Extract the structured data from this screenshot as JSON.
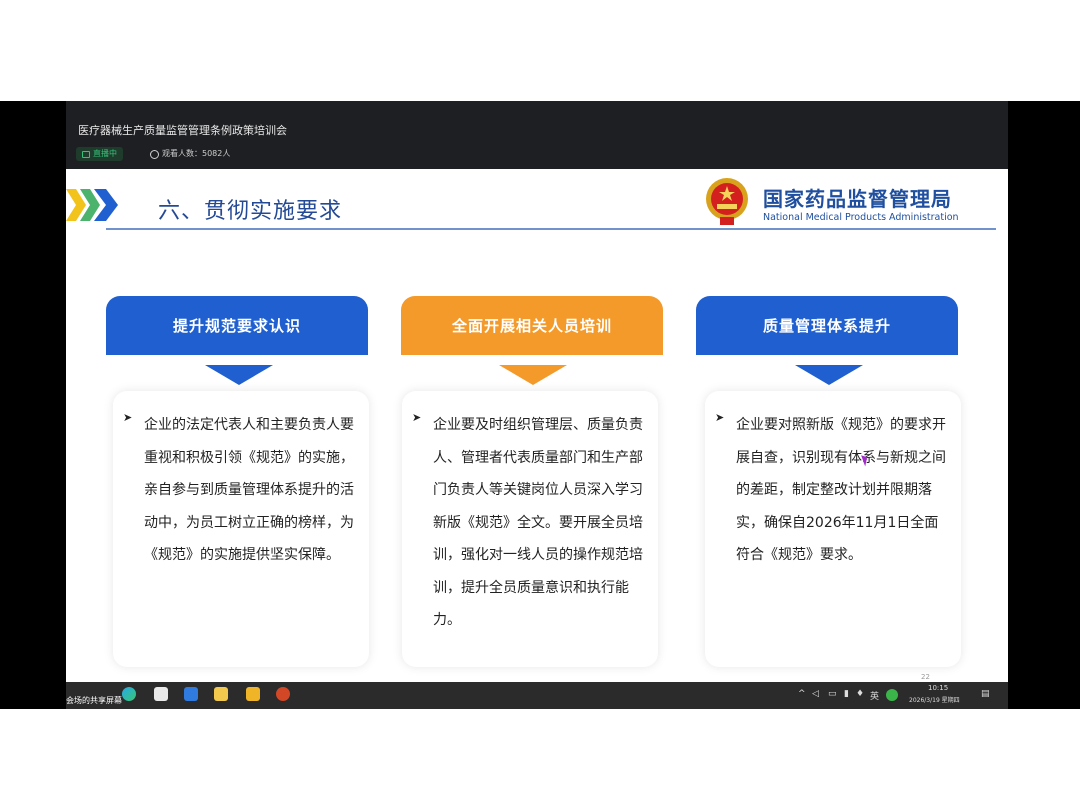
{
  "meeting": {
    "title": "医疗器械生产质量监管管理条例政策培训会",
    "live_label": "直播中",
    "viewers_label": "观看人数：5082人"
  },
  "slide": {
    "heading": "六、贯彻实施要求",
    "agency_cn": "国家药品监督管理局",
    "agency_en": "National Medical Products Administration",
    "page_number": "22",
    "columns": [
      {
        "header": "提升规范要求认识",
        "color": "#1f5fcf",
        "bullet": "➤",
        "text": "企业的法定代表人和主要负责人要重视和积极引领《规范》的实施，亲自参与到质量管理体系提升的活动中，为员工树立正确的榜样，为《规范》的实施提供坚实保障。"
      },
      {
        "header": "全面开展相关人员培训",
        "color": "#f49a2a",
        "bullet": "➤",
        "text": "企业要及时组织管理层、质量负责人、管理者代表质量部门和生产部门负责人等关键岗位人员深入学习新版《规范》全文。要开展全员培训，强化对一线人员的操作规范培训，提升全员质量意识和执行能力。"
      },
      {
        "header": "质量管理体系提升",
        "color": "#1f5fcf",
        "bullet": "➤",
        "text": "企业要对照新版《规范》的要求开展自查，识别现有体系与新规之间的差距，制定整改计划并限期落实，确保自2026年11月1日全面符合《规范》要求。"
      }
    ]
  },
  "taskbar": {
    "share_label": "会场的共享屏幕",
    "ime_label": "英",
    "time": "10:15",
    "date": "2026/3/19 星期四",
    "icons": [
      "start-icon",
      "edge-icon",
      "wechat-icon",
      "photos-icon",
      "media-icon",
      "file-explorer-icon",
      "powerpoint-icon"
    ]
  }
}
